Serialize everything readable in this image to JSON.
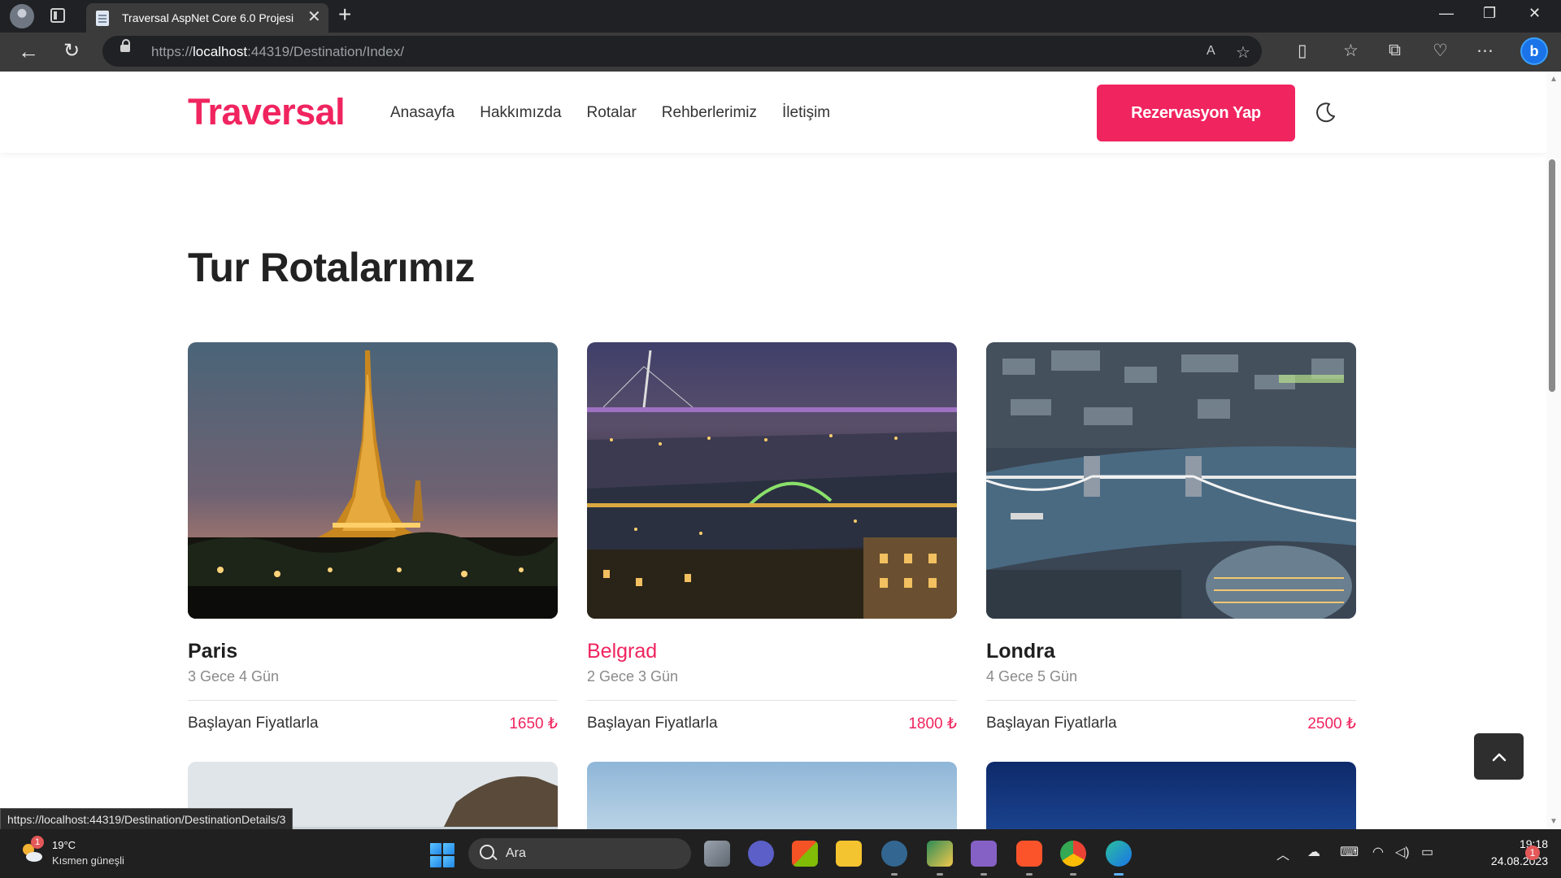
{
  "browser": {
    "tab_title": "Traversal AspNet Core 6.0 Projesi",
    "tab_close": "✕",
    "new_tab": "+",
    "url_prefix": "https://",
    "url_host": "localhost",
    "url_rest": ":44319/Destination/Index/",
    "window_controls": [
      "—",
      "❐",
      "✕"
    ],
    "bing_label": "b"
  },
  "site": {
    "logo": "Traversal",
    "nav": [
      "Anasayfa",
      "Hakkımızda",
      "Rotalar",
      "Rehberlerimiz",
      "İletişim"
    ],
    "cta": "Rezervasyon Yap",
    "accent_color": "#f0245f",
    "theme_icon": "moon-icon"
  },
  "section_title": "Tur Rotalarımız",
  "destinations": [
    {
      "name": "Paris",
      "duration": "3 Gece 4 Gün",
      "price_label": "Başlayan Fiyatlarla",
      "price": "1650 ₺",
      "image": "eiffel-tower-night"
    },
    {
      "name": "Belgrad",
      "duration": "2 Gece 3 Gün",
      "price_label": "Başlayan Fiyatlarla",
      "price": "1800 ₺",
      "image": "belgrade-bridges-night",
      "hovered": true
    },
    {
      "name": "Londra",
      "duration": "4 Gece 5 Gün",
      "price_label": "Başlayan Fiyatlarla",
      "price": "2500 ₺",
      "image": "tower-bridge-aerial"
    }
  ],
  "status_bar_url": "https://localhost:44319/Destination/DestinationDetails/3",
  "taskbar": {
    "weather_temp": "19°C",
    "weather_desc": "Kısmen güneşli",
    "weather_badge": "1",
    "search_placeholder": "Ara",
    "time": "19:18",
    "date": "24.08.2023",
    "notification_count": "1"
  }
}
